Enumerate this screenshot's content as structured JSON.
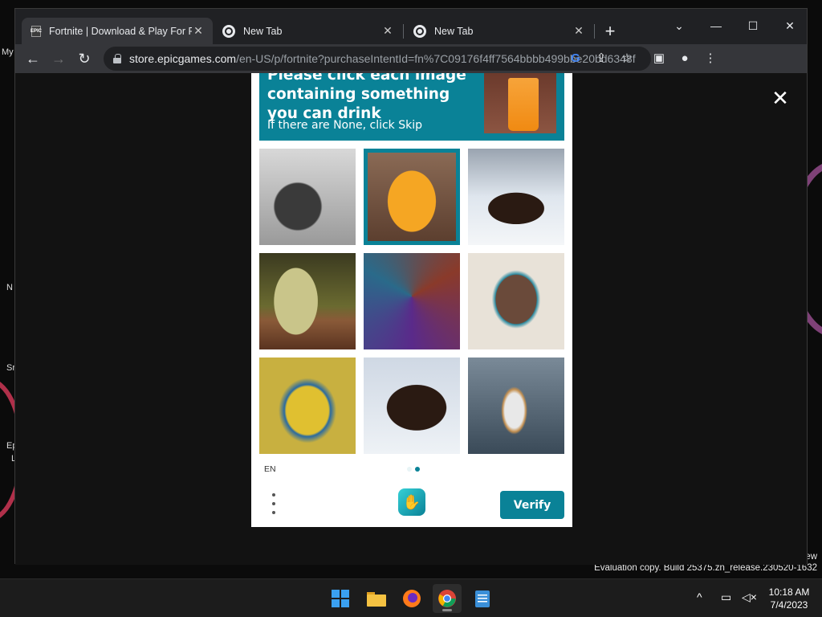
{
  "desktop": {
    "icon_labels": [
      "My",
      "N",
      "Sr",
      "Ep",
      "L"
    ],
    "watermark_line1": "ew",
    "watermark_line2": "Evaluation copy. Build 25375.zn_release.230520-1632"
  },
  "browser": {
    "tabs": [
      {
        "title": "Fortnite | Download & Play For F",
        "active": true,
        "favicon": "epic-games-icon"
      },
      {
        "title": "New Tab",
        "active": false,
        "favicon": "chrome-icon"
      },
      {
        "title": "New Tab",
        "active": false,
        "favicon": "chrome-icon"
      }
    ],
    "new_tab_glyph": "+",
    "window_controls": {
      "dropdown": "⌄",
      "minimize": "—",
      "maximize": "☐",
      "close": "✕"
    },
    "url_host": "store.epicgames.com",
    "url_path": "/en-US/p/fortnite?purchaseIntentId=fn%7C09176f4ff7564bbbb499bbe20bd6348f"
  },
  "captcha": {
    "prompt_title": "Please click each image containing something you can drink",
    "prompt_subtitle": "If there are None, click Skip",
    "language": "EN",
    "verify_label": "Verify",
    "accent": "#0a8297",
    "images": [
      {
        "subject": "grayscale puppy sketch",
        "selected": false
      },
      {
        "subject": "glass of orange juice",
        "selected": true
      },
      {
        "subject": "bear walking in snow",
        "selected": false
      },
      {
        "subject": "glass of lemon water",
        "selected": false
      },
      {
        "subject": "abstract colorful mask",
        "selected": false
      },
      {
        "subject": "painted dog portrait",
        "selected": false
      },
      {
        "subject": "pop art bulldog",
        "selected": false
      },
      {
        "subject": "bear on snow",
        "selected": false
      },
      {
        "subject": "glass of iced drink",
        "selected": false
      }
    ],
    "page_dots": 2,
    "active_page": 2
  },
  "taskbar": {
    "apps": [
      "start-icon",
      "file-explorer-icon",
      "firefox-icon",
      "chrome-icon",
      "notepad-icon"
    ],
    "active_app": "chrome-icon",
    "tray_chevron": "^",
    "time": "10:18 AM",
    "date": "7/4/2023"
  }
}
